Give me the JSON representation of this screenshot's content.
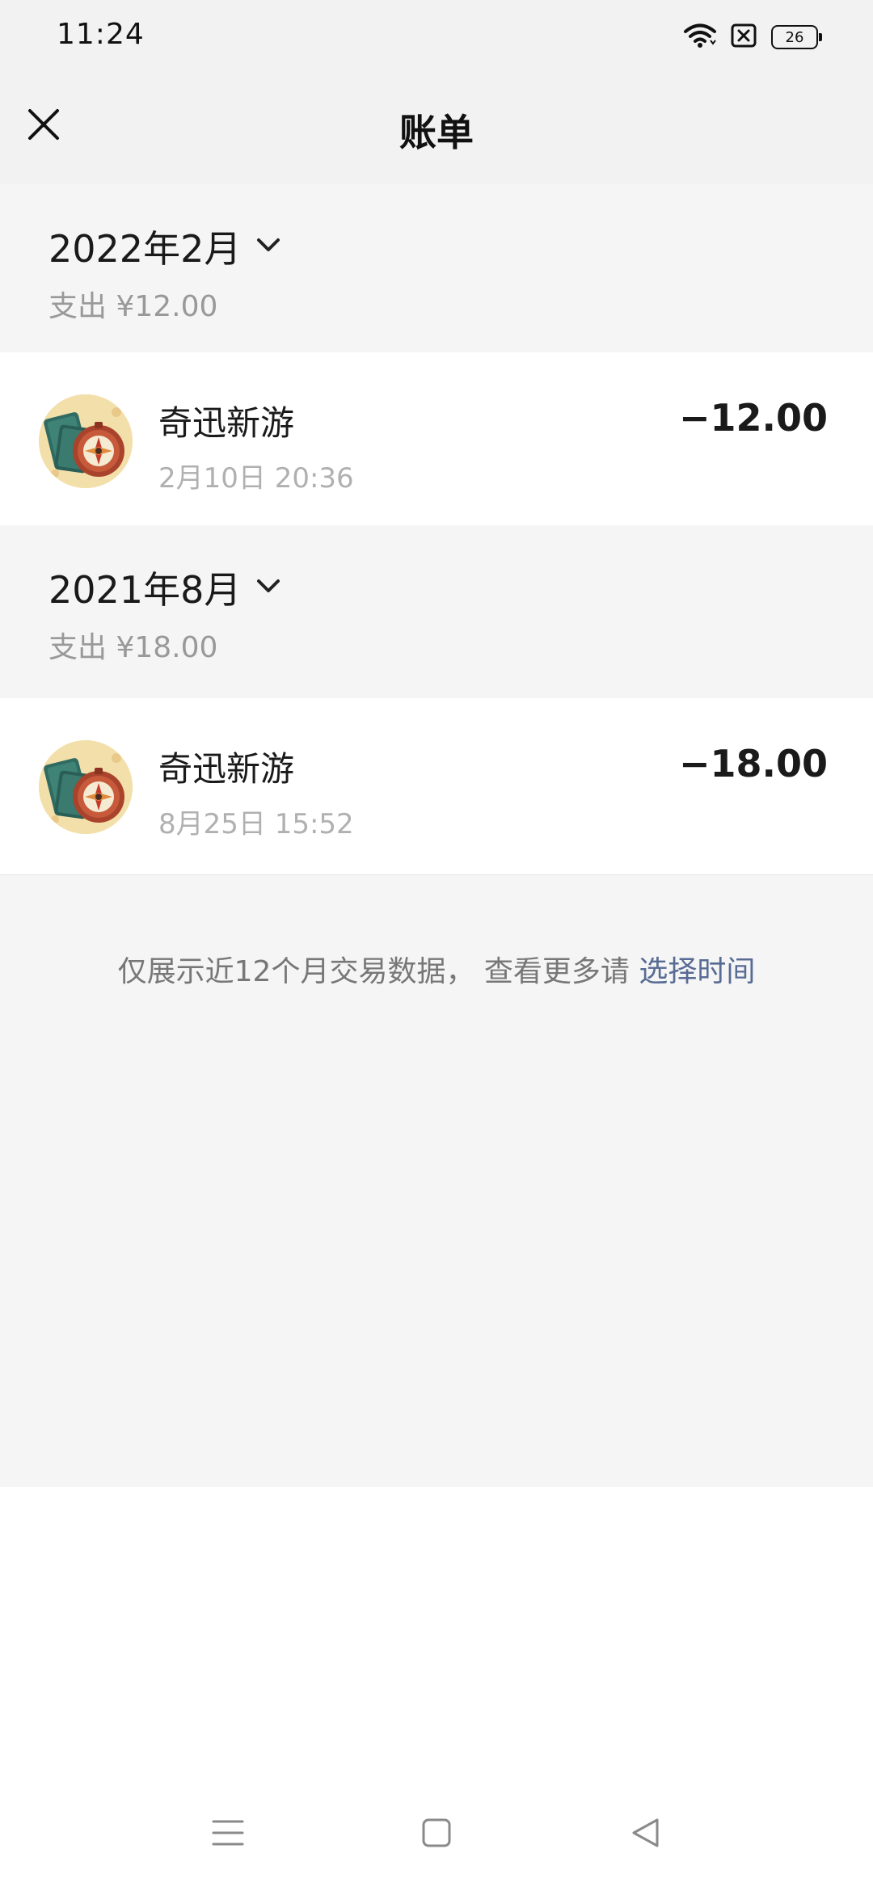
{
  "status_bar": {
    "time": "11:24",
    "battery_level": "26",
    "icons": [
      "wifi-icon",
      "sim-off-icon",
      "battery-icon"
    ]
  },
  "header": {
    "title": "账单",
    "close_icon": "close-icon"
  },
  "groups": [
    {
      "month": "2022年2月",
      "summary": "支出 ¥12.00",
      "transactions": [
        {
          "name": "奇迅新游",
          "time": "2月10日 20:36",
          "amount": "−12.00",
          "avatar_icon": "game-compass-icon"
        }
      ]
    },
    {
      "month": "2021年8月",
      "summary": "支出 ¥18.00",
      "transactions": [
        {
          "name": "奇迅新游",
          "time": "8月25日 15:52",
          "amount": "−18.00",
          "avatar_icon": "game-compass-icon"
        }
      ]
    }
  ],
  "footer_notice": {
    "text": "仅展示近12个月交易数据， 查看更多请 ",
    "link": "选择时间"
  },
  "nav_bar": {
    "icons": [
      "menu-icon",
      "home-icon",
      "back-icon"
    ]
  },
  "colors": {
    "link": "#576b95",
    "background": "#f5f5f5",
    "secondary_text": "#999999"
  }
}
